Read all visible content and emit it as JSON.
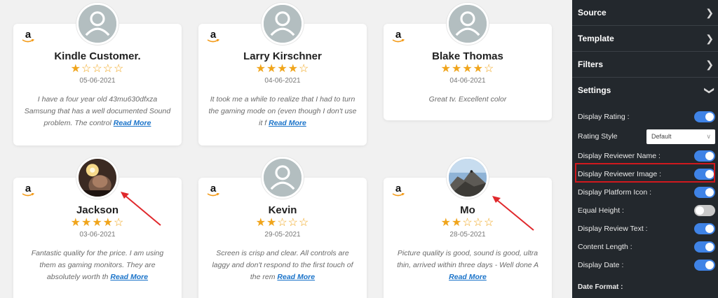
{
  "reviews": [
    {
      "name": "Kindle Customer.",
      "rating": 1,
      "stars": "★☆☆☆☆",
      "date": "05-06-2021",
      "text": "I have a four year old 43mu630dfxza Samsung that has a well documented Sound problem. The control",
      "read_more": "Read More",
      "avatar": "placeholder"
    },
    {
      "name": "Larry Kirschner",
      "rating": 4,
      "stars": "★★★★☆",
      "date": "04-06-2021",
      "text": "It took me a while to realize that I had to turn the gaming mode on (even though I don't use it f",
      "read_more": "Read More",
      "avatar": "placeholder"
    },
    {
      "name": "Blake Thomas",
      "rating": 4,
      "stars": "★★★★☆",
      "date": "04-06-2021",
      "text": "Great tv. Excellent color",
      "read_more": "",
      "avatar": "placeholder"
    },
    {
      "name": "Jackson",
      "rating": 4,
      "stars": "★★★★☆",
      "date": "03-06-2021",
      "text": "Fantastic quality for the price. I am using them as gaming monitors. They are absolutely worth th",
      "read_more": "Read More",
      "avatar": "photo-dark"
    },
    {
      "name": "Kevin",
      "rating": 2,
      "stars": "★★☆☆☆",
      "date": "29-05-2021",
      "text": "Screen is crisp and clear. All controls are laggy and don't respond to the first touch of the rem",
      "read_more": "Read More",
      "avatar": "placeholder"
    },
    {
      "name": "Mo",
      "rating": 2,
      "stars": "★★☆☆☆",
      "date": "28-05-2021",
      "text": "Picture quality is good, sound is good, ultra thin, arrived within three days - Well done A",
      "read_more": "Read More",
      "avatar": "photo-mountain"
    }
  ],
  "platform_icon": {
    "letter": "a",
    "icon": "amazon-icon"
  },
  "panel": {
    "sections": [
      {
        "label": "Source",
        "icon": "chevron-right-icon"
      },
      {
        "label": "Template",
        "icon": "chevron-right-icon"
      },
      {
        "label": "Filters",
        "icon": "chevron-right-icon"
      },
      {
        "label": "Settings",
        "icon": "chevron-down-icon"
      }
    ],
    "settings": [
      {
        "label": "Display Rating :",
        "on": true
      },
      {
        "label": "Rating Style",
        "select": "Default"
      },
      {
        "label": "Display Reviewer Name :",
        "on": true
      },
      {
        "label": "Display Reviewer Image :",
        "on": true
      },
      {
        "label": "Display Platform Icon :",
        "on": true
      },
      {
        "label": "Equal Height :",
        "on": false
      },
      {
        "label": "Display Review Text :",
        "on": true
      },
      {
        "label": "Content Length :",
        "on": true
      },
      {
        "label": "Display Date :",
        "on": true
      }
    ],
    "date_format_label": "Date Format :"
  },
  "colors": {
    "star": "#f0a51c",
    "link": "#1a73c9",
    "toggle_on": "#3f83e6",
    "panel_bg": "#23282d",
    "highlight": "#d0191e",
    "arrow": "#e0282c"
  }
}
